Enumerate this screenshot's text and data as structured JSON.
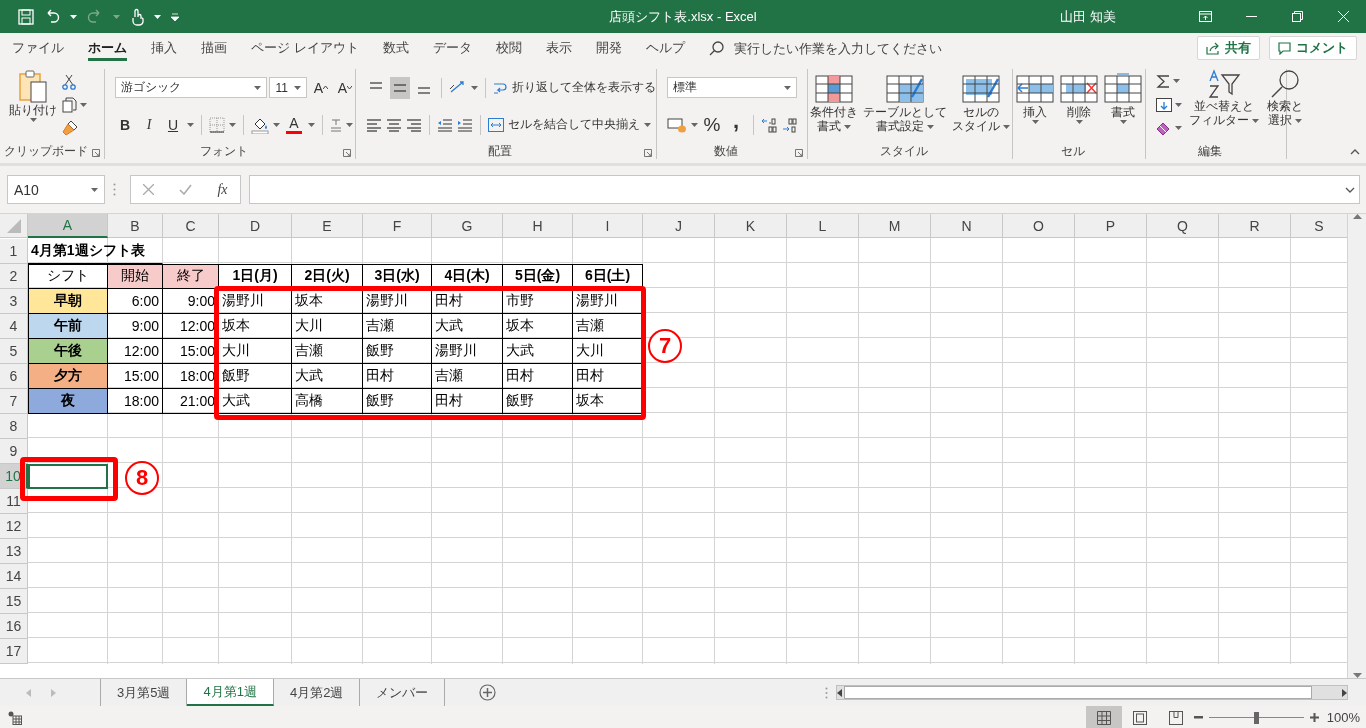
{
  "title_bar": {
    "title": "店頭シフト表.xlsx  -  Excel",
    "user": "山田 知美"
  },
  "menu_tabs": [
    {
      "label": "ファイル",
      "selected": false
    },
    {
      "label": "ホーム",
      "selected": true
    },
    {
      "label": "挿入",
      "selected": false
    },
    {
      "label": "描画",
      "selected": false
    },
    {
      "label": "ページ レイアウト",
      "selected": false
    },
    {
      "label": "数式",
      "selected": false
    },
    {
      "label": "データ",
      "selected": false
    },
    {
      "label": "校閲",
      "selected": false
    },
    {
      "label": "表示",
      "selected": false
    },
    {
      "label": "開発",
      "selected": false
    },
    {
      "label": "ヘルプ",
      "selected": false
    }
  ],
  "tell_me": {
    "placeholder": "実行したい作業を入力してください"
  },
  "share_button": "共有",
  "comment_button": "コメント",
  "ribbon": {
    "clipboard": {
      "label": "クリップボード",
      "paste": "貼り付け"
    },
    "font": {
      "label": "フォント",
      "name": "游ゴシック",
      "size": "11",
      "grow": "A",
      "shrink": "A",
      "bold": "B",
      "italic": "I",
      "underline": "U",
      "font_color": "A"
    },
    "alignment": {
      "label": "配置",
      "vertical": [
        {
          "selected": false
        },
        {
          "selected": true
        },
        {
          "selected": false
        }
      ],
      "wrap_text": "折り返して全体を表示する",
      "merge_center": "セルを結合して中央揃え"
    },
    "number": {
      "label": "数値",
      "format": "標準",
      "percent": "%",
      "comma": ","
    },
    "styles": {
      "label": "スタイル",
      "buttons": [
        {
          "lines": [
            "条件付き",
            "書式"
          ]
        },
        {
          "lines": [
            "テーブルとして",
            "書式設定"
          ]
        },
        {
          "lines": [
            "セルの",
            "スタイル"
          ]
        }
      ]
    },
    "cells": {
      "label": "セル",
      "buttons": [
        "挿入",
        "削除",
        "書式"
      ]
    },
    "editing": {
      "label": "編集",
      "sort_filter": [
        "並べ替えと",
        "フィルター"
      ],
      "find_select": [
        "検索と",
        "選択"
      ]
    }
  },
  "formula_bar": {
    "name_box": "A10",
    "function_button": "fx"
  },
  "columns": [
    {
      "label": "A",
      "selected": true
    },
    {
      "label": "B",
      "selected": false
    },
    {
      "label": "C",
      "selected": false
    },
    {
      "label": "D",
      "selected": false
    },
    {
      "label": "E",
      "selected": false
    },
    {
      "label": "F",
      "selected": false
    },
    {
      "label": "G",
      "selected": false
    },
    {
      "label": "H",
      "selected": false
    },
    {
      "label": "I",
      "selected": false
    },
    {
      "label": "J",
      "selected": false
    },
    {
      "label": "K",
      "selected": false
    },
    {
      "label": "L",
      "selected": false
    },
    {
      "label": "M",
      "selected": false
    },
    {
      "label": "N",
      "selected": false
    },
    {
      "label": "O",
      "selected": false
    },
    {
      "label": "P",
      "selected": false
    },
    {
      "label": "Q",
      "selected": false
    },
    {
      "label": "R",
      "selected": false
    },
    {
      "label": "S",
      "selected": false
    }
  ],
  "rows": [
    {
      "label": "1",
      "selected": false
    },
    {
      "label": "2",
      "selected": false
    },
    {
      "label": "3",
      "selected": false
    },
    {
      "label": "4",
      "selected": false
    },
    {
      "label": "5",
      "selected": false
    },
    {
      "label": "6",
      "selected": false
    },
    {
      "label": "7",
      "selected": false
    },
    {
      "label": "8",
      "selected": false
    },
    {
      "label": "9",
      "selected": false
    },
    {
      "label": "10",
      "selected": true
    },
    {
      "label": "11",
      "selected": false
    },
    {
      "label": "12",
      "selected": false
    },
    {
      "label": "13",
      "selected": false
    },
    {
      "label": "14",
      "selected": false
    },
    {
      "label": "15",
      "selected": false
    },
    {
      "label": "16",
      "selected": false
    },
    {
      "label": "17",
      "selected": false
    }
  ],
  "sheet": {
    "title": "4月第1週シフト表",
    "header": {
      "shift": "シフト",
      "start": {
        "text": "開始",
        "color": "#f8cbcb"
      },
      "end": {
        "text": "終了",
        "color": "#f8cbcb"
      },
      "days": [
        "1日(月)",
        "2日(火)",
        "3日(水)",
        "4日(木)",
        "5日(金)",
        "6日(土)"
      ]
    },
    "shifts": [
      {
        "name": "早朝",
        "color": "#ffe699",
        "start": "6:00",
        "end": "9:00",
        "staff": [
          "湯野川",
          "坂本",
          "湯野川",
          "田村",
          "市野",
          "湯野川"
        ]
      },
      {
        "name": "午前",
        "color": "#bdd7ee",
        "start": "9:00",
        "end": "12:00",
        "staff": [
          "坂本",
          "大川",
          "吉瀬",
          "大武",
          "坂本",
          "吉瀬"
        ]
      },
      {
        "name": "午後",
        "color": "#a9d08e",
        "start": "12:00",
        "end": "15:00",
        "staff": [
          "大川",
          "吉瀬",
          "飯野",
          "湯野川",
          "大武",
          "大川"
        ]
      },
      {
        "name": "夕方",
        "color": "#f4b084",
        "start": "15:00",
        "end": "18:00",
        "staff": [
          "飯野",
          "大武",
          "田村",
          "吉瀬",
          "田村",
          "田村"
        ]
      },
      {
        "name": "夜",
        "color": "#8ea9db",
        "start": "18:00",
        "end": "21:00",
        "staff": [
          "大武",
          "高橋",
          "飯野",
          "田村",
          "飯野",
          "坂本"
        ]
      }
    ]
  },
  "callouts": [
    {
      "label": "7"
    },
    {
      "label": "8"
    }
  ],
  "sheet_tabs": [
    {
      "label": "3月第5週",
      "selected": false
    },
    {
      "label": "4月第1週",
      "selected": true
    },
    {
      "label": "4月第2週",
      "selected": false
    },
    {
      "label": "メンバー",
      "selected": false
    }
  ],
  "status_bar": {
    "zoom": "100%",
    "zoom_slider": {
      "level": 0.5
    }
  }
}
